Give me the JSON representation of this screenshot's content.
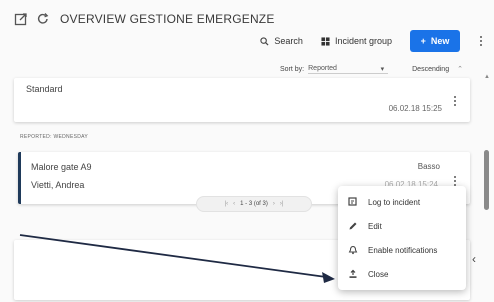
{
  "header": {
    "title": "OVERVIEW GESTIONE EMERGENZE",
    "edit_icon": "open-external-icon",
    "refresh_icon": "refresh-icon"
  },
  "toolbar": {
    "search_label": "Search",
    "group_label": "Incident group",
    "new_label": "New"
  },
  "sort": {
    "label": "Sort by:",
    "value": "Reported",
    "direction": "Descending"
  },
  "cards": [
    {
      "name": "Standard",
      "date": "06.02.18 15:25"
    },
    {
      "name": "Malore gate A9",
      "person": "Vietti, Andrea",
      "priority": "Basso",
      "date": "06.02.18 15:24"
    }
  ],
  "section_label": "REPORTED: WEDNESDAY",
  "pager": {
    "text": "1 - 3 (of 3)"
  },
  "menu": {
    "items": [
      {
        "label": "Log to incident",
        "icon": "log-icon"
      },
      {
        "label": "Edit",
        "icon": "pencil-icon"
      },
      {
        "label": "Enable notifications",
        "icon": "bell-icon"
      },
      {
        "label": "Close",
        "icon": "close-upload-icon"
      }
    ]
  },
  "colors": {
    "accent": "#1a73e8",
    "card_border": "#1f3a5a",
    "annotation": "#1f2a44"
  }
}
